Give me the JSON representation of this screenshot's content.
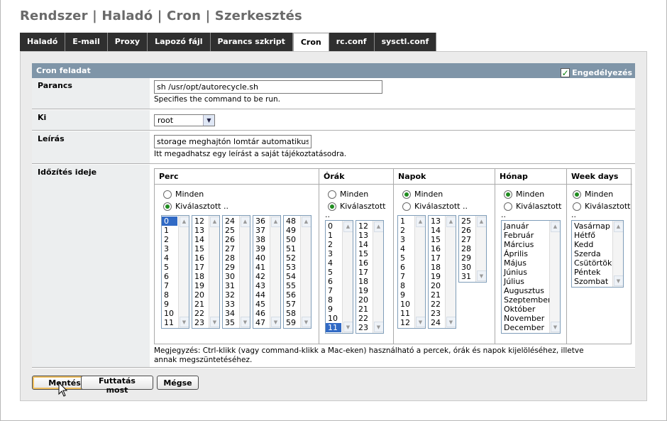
{
  "page": {
    "title": "Rendszer | Haladó | Cron | Szerkesztés"
  },
  "tabs": [
    {
      "label": "Haladó",
      "active": false
    },
    {
      "label": "E-mail",
      "active": false
    },
    {
      "label": "Proxy",
      "active": false
    },
    {
      "label": "Lapozó fájl",
      "active": false
    },
    {
      "label": "Parancs szkript",
      "active": false
    },
    {
      "label": "Cron",
      "active": true
    },
    {
      "label": "rc.conf",
      "active": false
    },
    {
      "label": "sysctl.conf",
      "active": false
    }
  ],
  "section": {
    "title": "Cron feladat",
    "enable_label": "Engedélyezés",
    "enable_checked": true
  },
  "command": {
    "label": "Parancs",
    "value": "sh /usr/opt/autorecycle.sh",
    "hint": "Specifies the command to be run."
  },
  "who": {
    "label": "Ki",
    "value": "root"
  },
  "description": {
    "label": "Leírás",
    "value": "storage meghajtón lomtár automatikus ürítése",
    "hint": "Itt megadhatsz egy leírást a saját tájékoztatásodra."
  },
  "schedule": {
    "label": "Időzítés ideje",
    "minute": {
      "header": "Perc",
      "all_label": "Minden",
      "selected_label": "Kiválasztott ..",
      "mode": "selected",
      "lists": [
        [
          "0",
          "1",
          "2",
          "3",
          "4",
          "5",
          "6",
          "7",
          "8",
          "9",
          "10",
          "11"
        ],
        [
          "12",
          "13",
          "14",
          "15",
          "16",
          "17",
          "18",
          "19",
          "20",
          "21",
          "22",
          "23"
        ],
        [
          "24",
          "25",
          "26",
          "27",
          "28",
          "29",
          "30",
          "31",
          "32",
          "33",
          "34",
          "35"
        ],
        [
          "36",
          "37",
          "38",
          "39",
          "40",
          "41",
          "42",
          "43",
          "44",
          "45",
          "46",
          "47"
        ],
        [
          "48",
          "49",
          "50",
          "51",
          "52",
          "53",
          "54",
          "55",
          "56",
          "57",
          "58",
          "59"
        ]
      ],
      "selected_value": "0"
    },
    "hour": {
      "header": "Órák",
      "all_label": "Minden",
      "selected_label": "Kiválasztott",
      "mode": "selected",
      "lists": [
        [
          "0",
          "1",
          "2",
          "3",
          "4",
          "5",
          "6",
          "7",
          "8",
          "9",
          "10",
          "11"
        ],
        [
          "12",
          "13",
          "14",
          "15",
          "16",
          "17",
          "18",
          "19",
          "20",
          "21",
          "22",
          "23"
        ]
      ],
      "selected_value": "11"
    },
    "day": {
      "header": "Napok",
      "all_label": "Minden",
      "selected_label": "Kiválasztott ..",
      "mode": "all",
      "lists": [
        [
          "1",
          "2",
          "3",
          "4",
          "5",
          "6",
          "7",
          "8",
          "9",
          "10",
          "11",
          "12"
        ],
        [
          "13",
          "14",
          "15",
          "16",
          "17",
          "18",
          "19",
          "20",
          "21",
          "22",
          "23",
          "24"
        ],
        [
          "25",
          "26",
          "27",
          "28",
          "29",
          "30",
          "31"
        ]
      ]
    },
    "month": {
      "header": "Hónap",
      "all_label": "Minden",
      "selected_label": "Kiválasztott",
      "mode": "all",
      "items": [
        "Január",
        "Február",
        "Március",
        "Április",
        "Május",
        "Június",
        "Július",
        "Augusztus",
        "Szeptember",
        "Október",
        "November",
        "December"
      ]
    },
    "weekday": {
      "header": "Week days",
      "all_label": "Minden",
      "selected_label": "Kiválasztott",
      "mode": "all",
      "items": [
        "Vasárnap",
        "Hétfő",
        "Kedd",
        "Szerda",
        "Csütörtök",
        "Péntek",
        "Szombat"
      ]
    },
    "note": "Megjegyzés: Ctrl-klikk (vagy command-klikk a Mac-eken) használható a percek, órák és napok kijelöléséhez, illetve annak megszüntetéséhez."
  },
  "buttons": {
    "save": "Mentés",
    "run_now": "Futtatás most",
    "cancel": "Mégse"
  },
  "colors": {
    "tab_bg": "#2f2f2f",
    "section_head": "#7f95a8",
    "label_bg": "#eceeef",
    "selection": "#316ac5",
    "radio_dot": "#1f8c1f"
  }
}
